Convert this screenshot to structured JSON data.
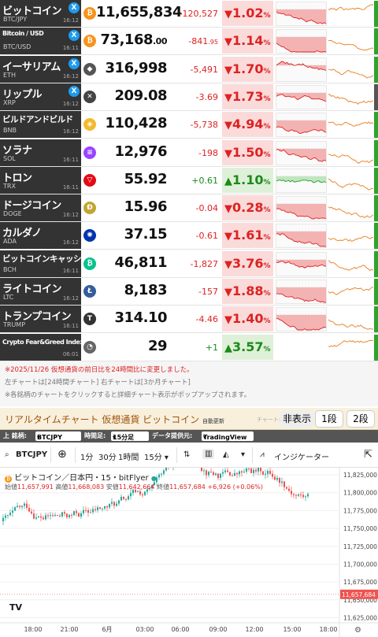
{
  "rows": [
    {
      "name": "ビットコイン",
      "sym": "BTC/JPY",
      "time": "16:12",
      "x": true,
      "icon": "₿",
      "iconColor": "#f7931a",
      "price": "11,655,834",
      "priceDec": "",
      "change": "-120,527",
      "changeDec": "",
      "dir": "down",
      "pct": "1.02",
      "barColor": "#2da52d"
    },
    {
      "name": "Bitcoin / USD",
      "sym": "BTC/USD",
      "time": "16:11",
      "x": true,
      "icon": "₿",
      "iconColor": "#f7931a",
      "price": "73,168",
      "priceDec": ".00",
      "change": "-841",
      "changeDec": ".95",
      "dir": "down",
      "pct": "1.14",
      "barColor": "#2da52d"
    },
    {
      "name": "イーサリアム",
      "sym": "ETH",
      "time": "16:12",
      "x": true,
      "icon": "◆",
      "iconColor": "#555",
      "price": "316,998",
      "priceDec": "",
      "change": "-5,491",
      "changeDec": "",
      "dir": "down",
      "pct": "1.70",
      "barColor": "#2da52d"
    },
    {
      "name": "リップル",
      "sym": "XRP",
      "time": "16:12",
      "x": true,
      "icon": "✕",
      "iconColor": "#444",
      "price": "209.08",
      "priceDec": "",
      "change": "-3.69",
      "changeDec": "",
      "dir": "down",
      "pct": "1.73",
      "barColor": "#555"
    },
    {
      "name": "ビルドアンドビルド",
      "sym": "BNB",
      "time": "16:12",
      "x": false,
      "icon": "◈",
      "iconColor": "#f3ba2f",
      "price": "110,428",
      "priceDec": "",
      "change": "-5,738",
      "changeDec": "",
      "dir": "down",
      "pct": "4.94",
      "barColor": "#2da52d"
    },
    {
      "name": "ソラナ",
      "sym": "SOL",
      "time": "16:11",
      "x": false,
      "icon": "≡",
      "iconColor": "#9945ff",
      "price": "12,976",
      "priceDec": "",
      "change": "-198",
      "changeDec": "",
      "dir": "down",
      "pct": "1.50",
      "barColor": "#2da52d"
    },
    {
      "name": "トロン",
      "sym": "TRX",
      "time": "16:11",
      "x": false,
      "icon": "▽",
      "iconColor": "#e50915",
      "price": "55.92",
      "priceDec": "",
      "change": "+0.61",
      "changeDec": "",
      "dir": "up",
      "pct": "1.10",
      "barColor": "#2da52d"
    },
    {
      "name": "ドージコイン",
      "sym": "DOGE",
      "time": "16:12",
      "x": false,
      "icon": "Ð",
      "iconColor": "#c2a633",
      "price": "15.96",
      "priceDec": "",
      "change": "-0.04",
      "changeDec": "",
      "dir": "down",
      "pct": "0.28",
      "barColor": "#2da52d"
    },
    {
      "name": "カルダノ",
      "sym": "ADA",
      "time": "16:12",
      "x": false,
      "icon": "✺",
      "iconColor": "#0033ad",
      "price": "37.15",
      "priceDec": "",
      "change": "-0.61",
      "changeDec": "",
      "dir": "down",
      "pct": "1.61",
      "barColor": "#2da52d"
    },
    {
      "name": "ビットコインキャッシュ",
      "sym": "BCH",
      "time": "16:11",
      "x": false,
      "icon": "₿",
      "iconColor": "#0ac18e",
      "price": "46,811",
      "priceDec": "",
      "change": "-1,827",
      "changeDec": "",
      "dir": "down",
      "pct": "3.76",
      "barColor": "#2da52d"
    },
    {
      "name": "ライトコイン",
      "sym": "LTC",
      "time": "16:12",
      "x": false,
      "icon": "Ł",
      "iconColor": "#345d9d",
      "price": "8,183",
      "priceDec": "",
      "change": "-157",
      "changeDec": "",
      "dir": "down",
      "pct": "1.88",
      "barColor": "#2da52d"
    },
    {
      "name": "トランプコイン",
      "sym": "TRUMP",
      "time": "16:11",
      "x": false,
      "icon": "T",
      "iconColor": "#333",
      "price": "314.10",
      "priceDec": "",
      "change": "-4.46",
      "changeDec": "",
      "dir": "down",
      "pct": "1.40",
      "barColor": "#2da52d"
    },
    {
      "name": "Crypto Fear&Greed Index",
      "sym": "",
      "time": "06:01",
      "x": false,
      "icon": "◔",
      "iconColor": "#666",
      "price": "29",
      "priceDec": "",
      "change": "+1",
      "changeDec": "",
      "dir": "up",
      "pct": "3.57",
      "barColor": "#2da52d"
    }
  ],
  "notes": {
    "line1": "※2025/11/26 仮想通貨の前日比を24時間比に変更しました。",
    "line2": "左チャートは[24時間チャート] 右チャートは[3か月チャート]",
    "line3": "※各銘柄のチャートをクリックすると詳細チャート表示がポップアップされます。"
  },
  "rtbar": {
    "title": "リアルタイムチャート 仮想通貨 ビットコイン",
    "auto": "自動更新",
    "chartLabel": "チャート:",
    "hide": "非表示",
    "one": "1段",
    "two": "2段"
  },
  "selector": {
    "symLabel": "上 銘柄:",
    "symValue": "BTCJPY",
    "tfLabel": "時間足:",
    "tfValue": "15分足",
    "provLabel": "データ提供元:",
    "provValue": "TradingView"
  },
  "toolbar": {
    "symbol": "BTCJPY",
    "t1": "1分",
    "t2": "30分",
    "t3": "1時間",
    "t4": "15分",
    "indicators": "インジケーター"
  },
  "legend": {
    "title": "ビットコイン／日本円・15・bitFlyer",
    "openLabel": "始値",
    "open": "11,657,991",
    "highLabel": "高値",
    "high": "11,668,083",
    "lowLabel": "安値",
    "low": "11,642,664",
    "closeLabel": "終値",
    "close": "11,657,684",
    "delta": "+6,926 (+0.06%)"
  },
  "priceAxis": [
    "11,825,000",
    "11,800,000",
    "11,775,000",
    "11,750,000",
    "11,725,000",
    "11,700,000",
    "11,675,000",
    "11,650,000",
    "11,625,000"
  ],
  "lastPrice": "11,657,684",
  "timeAxis": [
    "18:00",
    "21:00",
    "6月",
    "03:00",
    "06:00",
    "09:00",
    "12:00",
    "15:00",
    "18:00"
  ],
  "colors": {
    "down": "#d22",
    "up": "#1a8a1a",
    "accent": "#f7931a",
    "candleUp": "#26a69a",
    "candleDown": "#ef5350"
  }
}
